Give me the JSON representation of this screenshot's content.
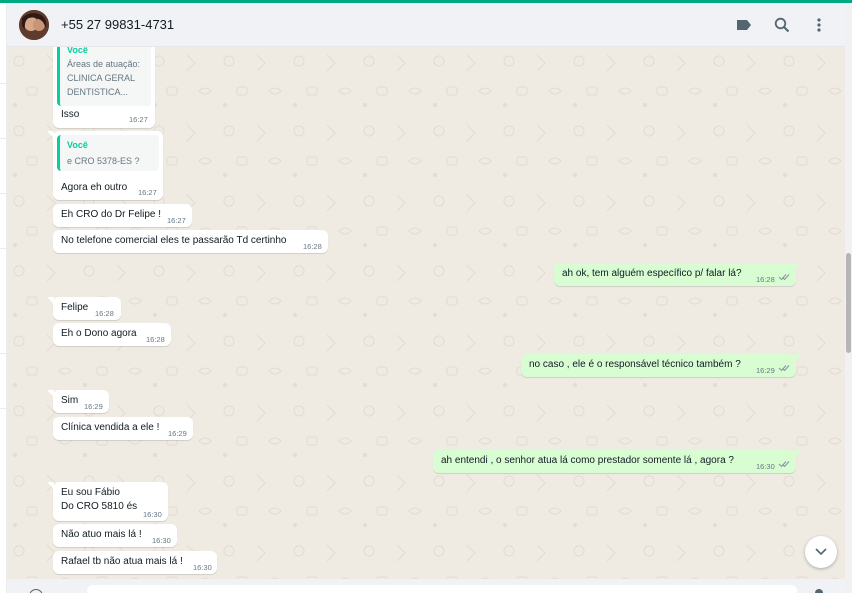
{
  "colors": {
    "accent": "#00a884",
    "incoming_bubble": "#ffffff",
    "outgoing_bubble": "#d9fdd3",
    "quote_bar": "#06cf9c",
    "read_ticks": "#53bdeb"
  },
  "header": {
    "contact_name": "+55 27 99831-4731",
    "icons": [
      "label-icon",
      "search-icon",
      "menu-icon"
    ]
  },
  "messages": [
    {
      "dir": "in",
      "quote_author": "Você",
      "quote_lines": [
        "Áreas de atuação:",
        "CLINICA GERAL",
        "DENTISTICA..."
      ],
      "text": "Isso",
      "time": "16:27"
    },
    {
      "dir": "in",
      "quote_author": "Você",
      "quote_lines": [
        "e CRO 5378-ES ?"
      ],
      "text": "Agora eh outro",
      "time": "16:27"
    },
    {
      "dir": "in",
      "text": "Eh CRO do Dr Felipe !",
      "time": "16:27"
    },
    {
      "dir": "in",
      "text": "No telefone comercial eles te passarão Td certinho",
      "time": "16:28"
    },
    {
      "dir": "out",
      "text": "ah ok, tem alguém específico p/ falar lá?",
      "time": "16:28",
      "status": "read"
    },
    {
      "dir": "in",
      "text": "Felipe",
      "time": "16:28"
    },
    {
      "dir": "in",
      "text": "Eh o Dono agora",
      "time": "16:28"
    },
    {
      "dir": "out",
      "text": "no caso , ele é o responsável técnico também ?",
      "time": "16:29",
      "status": "read"
    },
    {
      "dir": "in",
      "text": "Sim",
      "time": "16:29"
    },
    {
      "dir": "in",
      "text": "Clínica vendida a ele !",
      "time": "16:29"
    },
    {
      "dir": "out",
      "text": "ah entendi , o senhor atua lá como prestador somente lá , agora ?",
      "time": "16:30",
      "status": "read"
    },
    {
      "dir": "in",
      "text_lines": [
        "Eu sou Fábio",
        "Do CRO 5810 és"
      ],
      "time": "16:30"
    },
    {
      "dir": "in",
      "text": "Não atuo mais lá !",
      "time": "16:30"
    },
    {
      "dir": "in",
      "text": "Rafael tb não atua mais lá !",
      "time": "16:30"
    }
  ]
}
